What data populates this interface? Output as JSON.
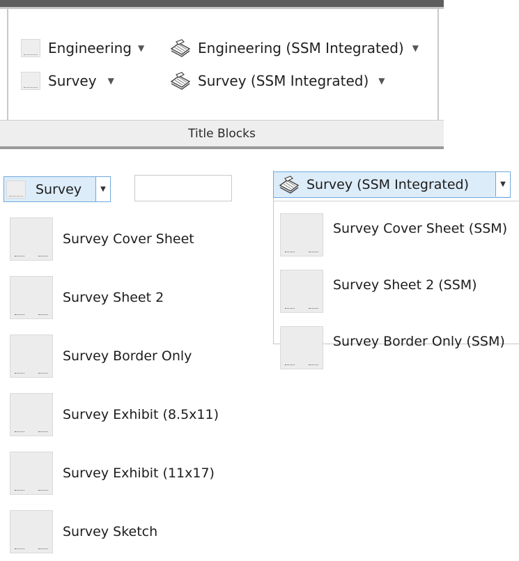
{
  "ribbon": {
    "panel_title": "Title Blocks",
    "items": [
      {
        "label": "Engineering",
        "icon": "blank-titleblock-icon"
      },
      {
        "label": "Survey",
        "icon": "blank-titleblock-icon"
      },
      {
        "label": "Engineering (SSM Integrated)",
        "icon": "ssm-stack-icon"
      },
      {
        "label": "Survey (SSM Integrated)",
        "icon": "ssm-stack-icon"
      }
    ]
  },
  "left_dropdown": {
    "selected": "Survey",
    "search_value": "",
    "items": [
      "Survey Cover Sheet",
      "Survey Sheet 2",
      "Survey Border Only",
      "Survey Exhibit (8.5x11)",
      "Survey Exhibit (11x17)",
      "Survey Sketch"
    ]
  },
  "right_dropdown": {
    "selected": "Survey (SSM Integrated)",
    "items": [
      "Survey Cover Sheet (SSM)",
      "Survey Sheet 2 (SSM)",
      "Survey Border Only (SSM)"
    ]
  },
  "colors": {
    "combo_bg": "#dcecf9",
    "combo_border": "#6fa8dc",
    "thumb_bg": "#ececec",
    "footer_bg": "#eeeeee"
  }
}
